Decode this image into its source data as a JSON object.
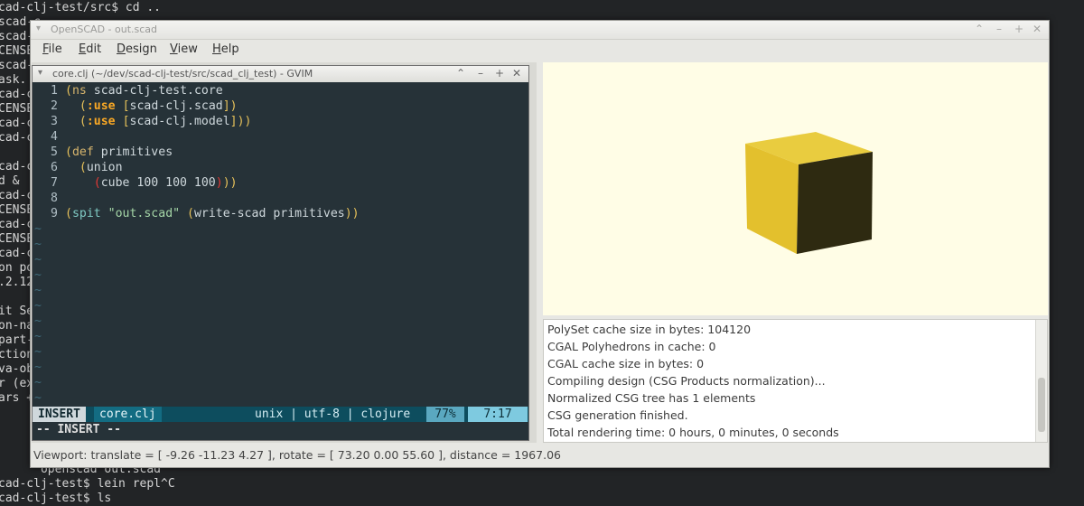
{
  "terminal": {
    "lines": [
      "cad-clj-test/src$ cd ..",
      "scad-c",
      "scad-c",
      "CENSE",
      "scad-c",
      "ask.",
      "cad-c",
      "CENSE",
      "cad-c",
      "cad-c",
      "",
      "cad-c",
      "d &",
      "cad-c",
      "CENSE",
      "cad-c",
      "CENSE",
      "cad-c",
      "on po",
      ".2.12",
      "",
      "it Se",
      "on-na",
      "part-",
      "ction",
      "va-ob",
      "r (ex",
      "ars +"
    ],
    "bottom_lines": [
      "      openscad out.scad",
      "cad-clj-test$ lein repl^C",
      "cad-clj-test$ ls"
    ]
  },
  "openscad": {
    "title": "OpenSCAD - out.scad",
    "menu": [
      "File",
      "Edit",
      "Design",
      "View",
      "Help"
    ],
    "console": [
      "PolySet cache size in bytes: 104120",
      "CGAL Polyhedrons in cache: 0",
      "CGAL cache size in bytes: 0",
      "Compiling design (CSG Products normalization)...",
      "Normalized CSG tree has 1 elements",
      "CSG generation finished.",
      "Total rendering time: 0 hours, 0 minutes, 0 seconds"
    ],
    "status": "Viewport: translate = [ -9.26 -11.23 4.27 ], rotate = [ 73.20 0.00 55.60 ], distance = 1967.06",
    "colors": {
      "cube_top": "#e8c83a",
      "cube_front": "#e2bf2c",
      "cube_side": "#2f2a10",
      "viewport_bg": "#fffde6"
    }
  },
  "gvim": {
    "title": "core.clj (~/dev/scad-clj-test/src/scad_clj_test) - GVIM",
    "code": {
      "l1_ns": "ns",
      "l1_name": "scad-clj-test.core",
      "l2_use": ":use",
      "l2_lib": "scad-clj.scad",
      "l3_use": ":use",
      "l3_lib": "scad-clj.model",
      "l5_def": "def",
      "l5_name": "primitives",
      "l6_union": "union",
      "l7_cube": "cube 100 100 100",
      "l9_spit": "spit",
      "l9_str": "\"out.scad\"",
      "l9_call": "write-scad primitives"
    },
    "line_numbers": [
      "1",
      "2",
      "3",
      "4",
      "5",
      "6",
      "7",
      "8",
      "9"
    ],
    "status": {
      "mode": "INSERT",
      "file": "core.clj",
      "encoding": "unix | utf-8 | clojure",
      "percent": "77%",
      "position": "7:17"
    },
    "cmdline": "-- INSERT --"
  }
}
